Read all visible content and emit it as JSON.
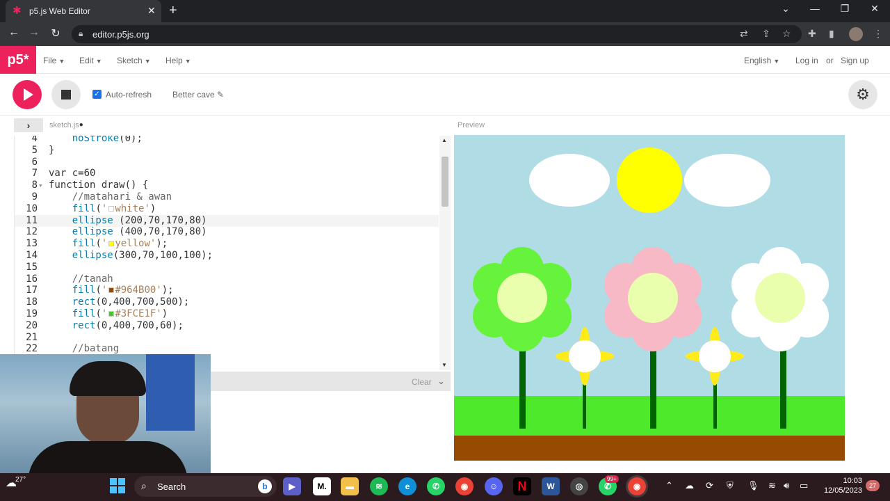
{
  "browser": {
    "tab_title": "p5.js Web Editor",
    "url": "editor.p5js.org"
  },
  "p5": {
    "logo": "p5*",
    "menus": [
      "File",
      "Edit",
      "Sketch",
      "Help"
    ],
    "language": "English",
    "login": "Log in",
    "or": "or",
    "signup": "Sign up",
    "auto_refresh": "Auto-refresh",
    "sketch_name": "Better cave",
    "file_tab": "sketch.js",
    "preview_label": "Preview",
    "console_clear": "Clear"
  },
  "code_lines": [
    {
      "n": "4",
      "code": "    noStroke(0);"
    },
    {
      "n": "5",
      "code": "}"
    },
    {
      "n": "6",
      "code": ""
    },
    {
      "n": "7",
      "code": "var c=60"
    },
    {
      "n": "8",
      "code": "function draw() {"
    },
    {
      "n": "9",
      "code": "    //matahari & awan"
    },
    {
      "n": "10",
      "code": "    fill('white')"
    },
    {
      "n": "11",
      "code": "    ellipse (200,70,170,80)"
    },
    {
      "n": "12",
      "code": "    ellipse (400,70,170,80)"
    },
    {
      "n": "13",
      "code": "    fill('yellow');"
    },
    {
      "n": "14",
      "code": "    ellipse(300,70,100,100);"
    },
    {
      "n": "15",
      "code": ""
    },
    {
      "n": "16",
      "code": "    //tanah"
    },
    {
      "n": "17",
      "code": "    fill('#964B00');"
    },
    {
      "n": "18",
      "code": "    rect(0,400,700,500);"
    },
    {
      "n": "19",
      "code": "    fill('#3FCE1F')"
    },
    {
      "n": "20",
      "code": "    rect(0,400,700,60);"
    },
    {
      "n": "21",
      "code": ""
    },
    {
      "n": "22",
      "code": "    //batang"
    }
  ],
  "colors": {
    "p5_pink": "#ed225d",
    "sky": "#b0dde5",
    "grass": "#4ee92b",
    "soil": "#964B00",
    "sun": "#ffff00",
    "stem": "#006400"
  },
  "taskbar": {
    "weather_temp": "27°",
    "search": "Search",
    "time": "10:03",
    "date": "12/05/2023",
    "notifications": "27",
    "badge": "99+"
  }
}
